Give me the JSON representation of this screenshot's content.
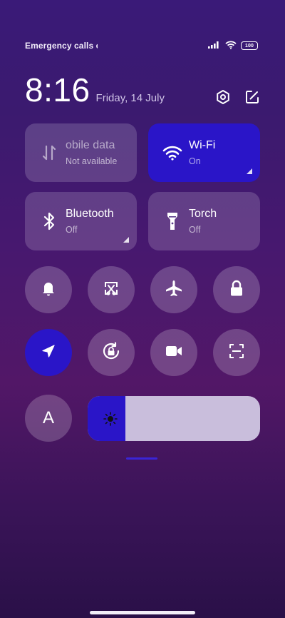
{
  "status": {
    "carrier_text": "Emergency calls o",
    "battery": "100",
    "icons": [
      "signal-icon",
      "wifi-icon",
      "battery-icon"
    ]
  },
  "header": {
    "time": "8:16",
    "date": "Friday, 14 July",
    "icons": [
      "settings-icon",
      "edit-icon"
    ]
  },
  "tiles": [
    {
      "name": "mobile-data",
      "label": "obile data",
      "full_label": "Mobile data",
      "sub": "Not available",
      "state": "unavailable",
      "icon": "mobile-data-icon"
    },
    {
      "name": "wifi",
      "label": "Wi-Fi",
      "sub": "On",
      "state": "on",
      "icon": "wifi-icon"
    },
    {
      "name": "bluetooth",
      "label": "Bluetooth",
      "sub": "Off",
      "state": "off",
      "icon": "bluetooth-icon"
    },
    {
      "name": "torch",
      "label": "Torch",
      "sub": "Off",
      "state": "off",
      "icon": "torch-icon"
    }
  ],
  "toggles_row1": [
    {
      "name": "notifications",
      "icon": "bell-icon",
      "state": "off"
    },
    {
      "name": "screenshot",
      "icon": "screenshot-icon",
      "state": "off"
    },
    {
      "name": "airplane-mode",
      "icon": "airplane-icon",
      "state": "off"
    },
    {
      "name": "lock-screen",
      "icon": "lock-icon",
      "state": "off"
    }
  ],
  "toggles_row2": [
    {
      "name": "location",
      "icon": "location-arrow-icon",
      "state": "on"
    },
    {
      "name": "auto-rotate",
      "icon": "rotation-lock-icon",
      "state": "off"
    },
    {
      "name": "screen-recorder",
      "icon": "video-camera-icon",
      "state": "off"
    },
    {
      "name": "scanner",
      "icon": "scan-icon",
      "state": "off"
    }
  ],
  "bottom_row": {
    "reading_mode_label": "A",
    "brightness_level": 0.22
  },
  "colors": {
    "active": "#2a15c8",
    "inactive": "rgba(255,255,255,0.17)",
    "background_top": "#3a1a78",
    "background_bottom": "#2a1048"
  }
}
